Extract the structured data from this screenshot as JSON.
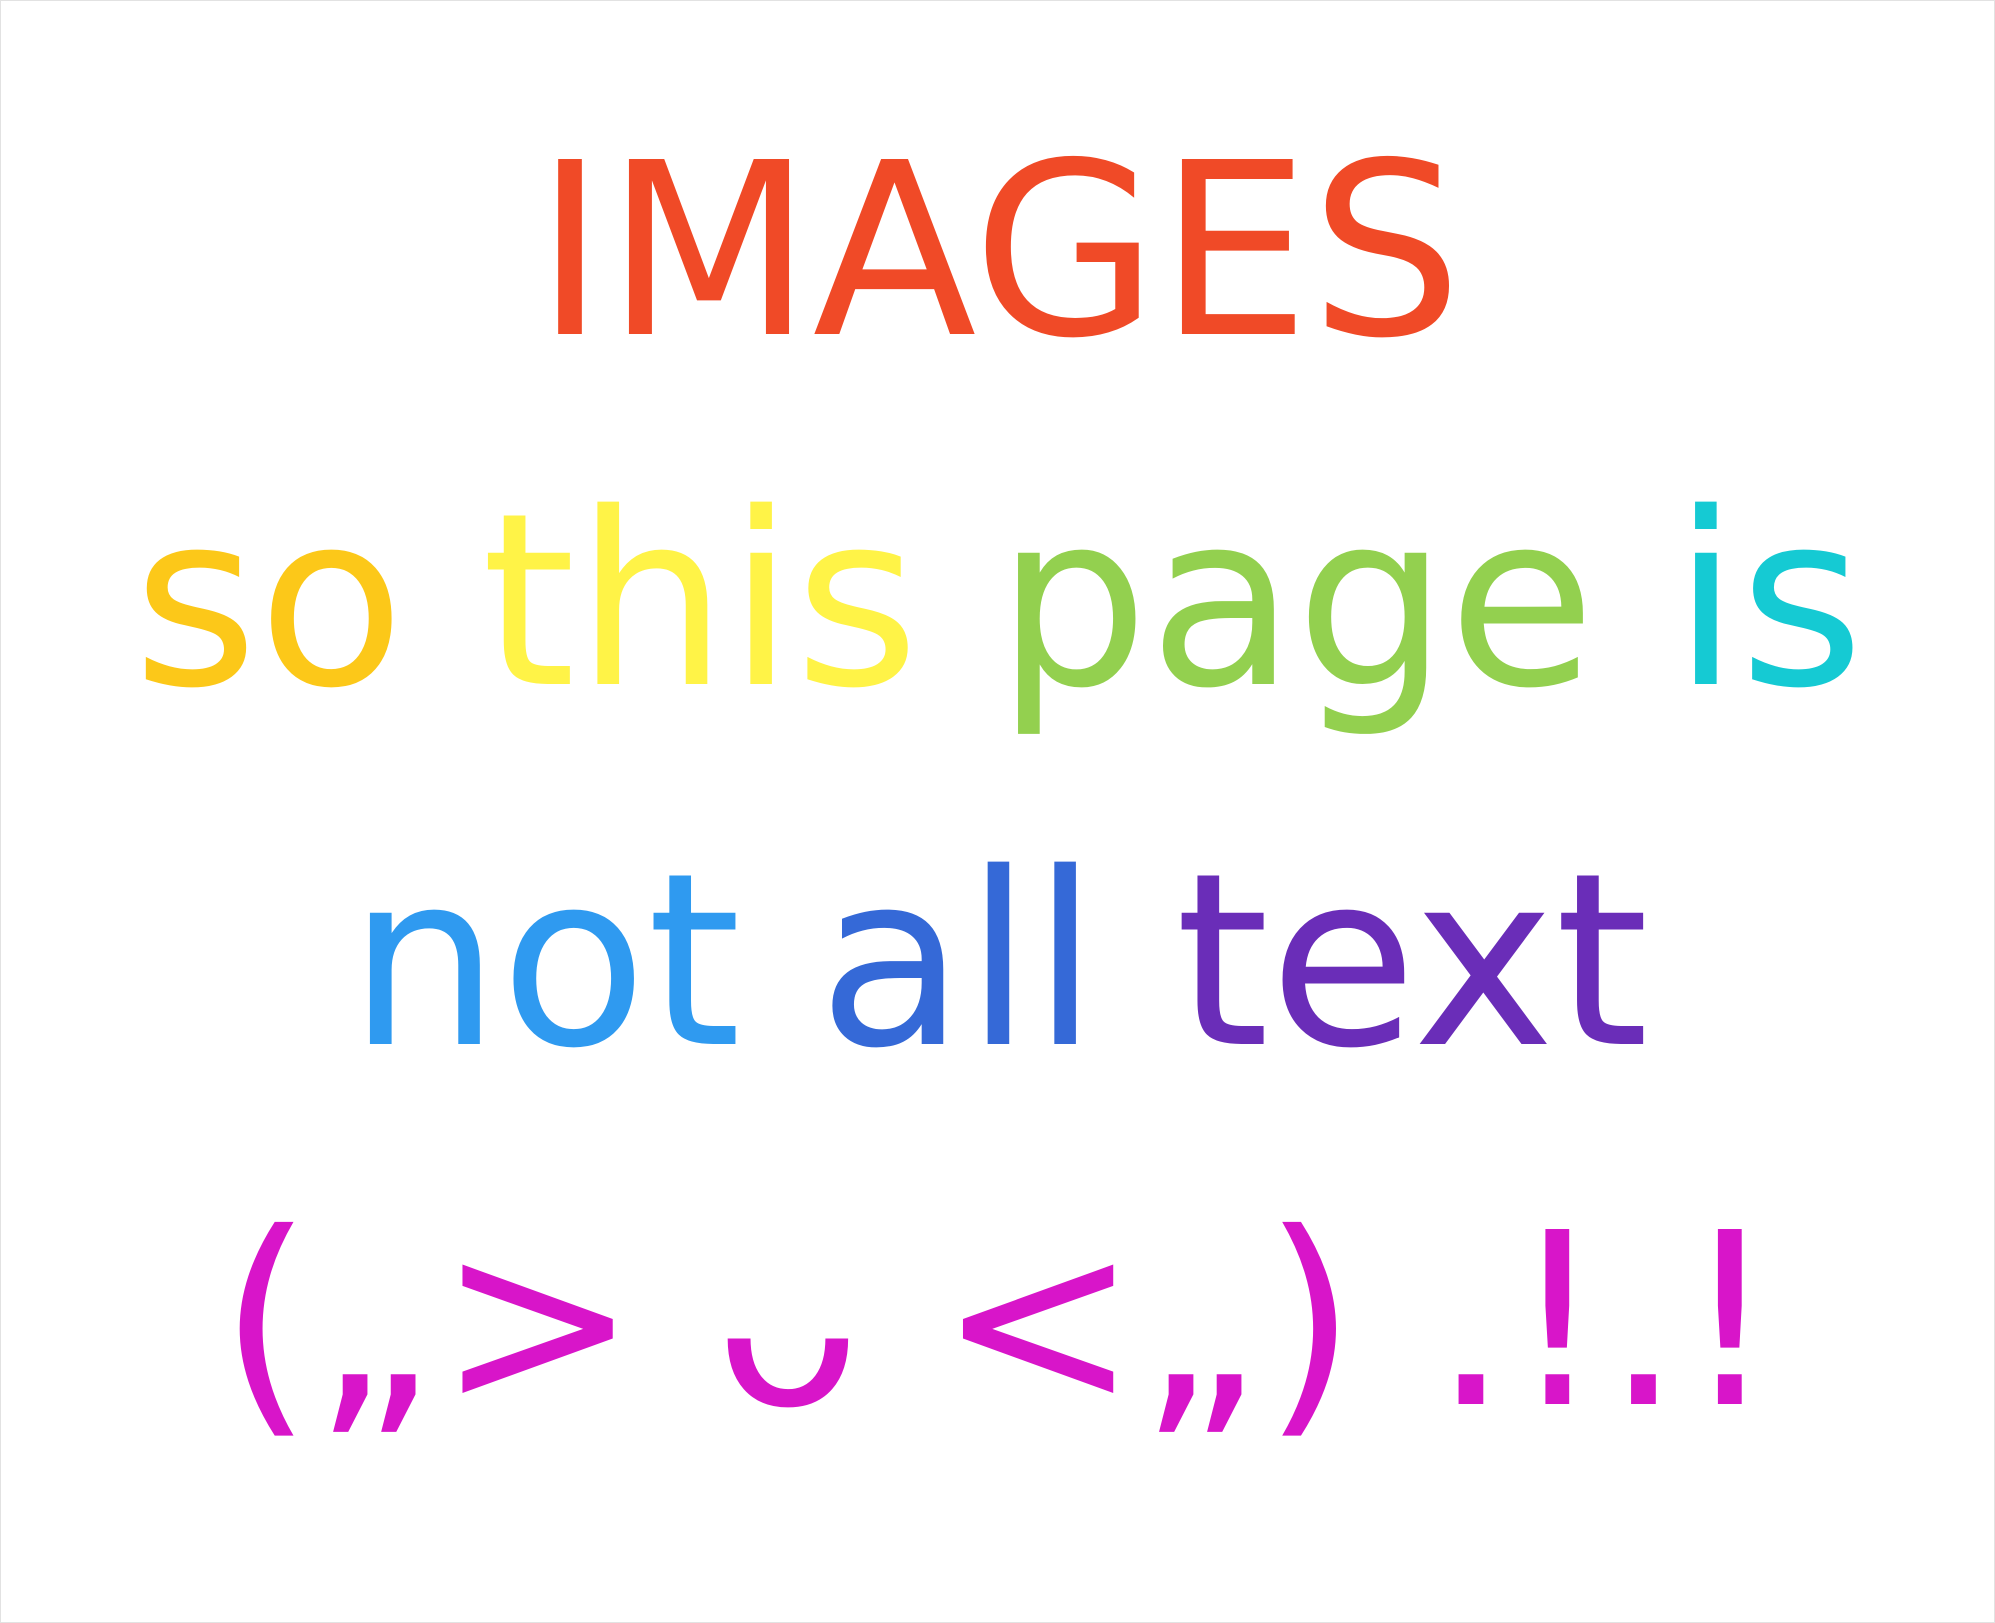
{
  "lines": [
    {
      "segments": [
        {
          "text": "IMAGES",
          "color": "#f04a27"
        }
      ]
    },
    {
      "segments": [
        {
          "text": "so",
          "color": "#fcc819"
        },
        {
          "text": "this",
          "color": "#fff347"
        },
        {
          "text": "page",
          "color": "#93d04f"
        },
        {
          "text": "is",
          "color": "#15cad3"
        }
      ]
    },
    {
      "segments": [
        {
          "text": "not",
          "color": "#2f9af0"
        },
        {
          "text": "all",
          "color": "#3569d7"
        },
        {
          "text": "text",
          "color": "#6a2db8"
        }
      ]
    },
    {
      "segments": [
        {
          "text": "(„> ᴗ <„) .!.!",
          "color": "#d815c9"
        }
      ]
    }
  ]
}
